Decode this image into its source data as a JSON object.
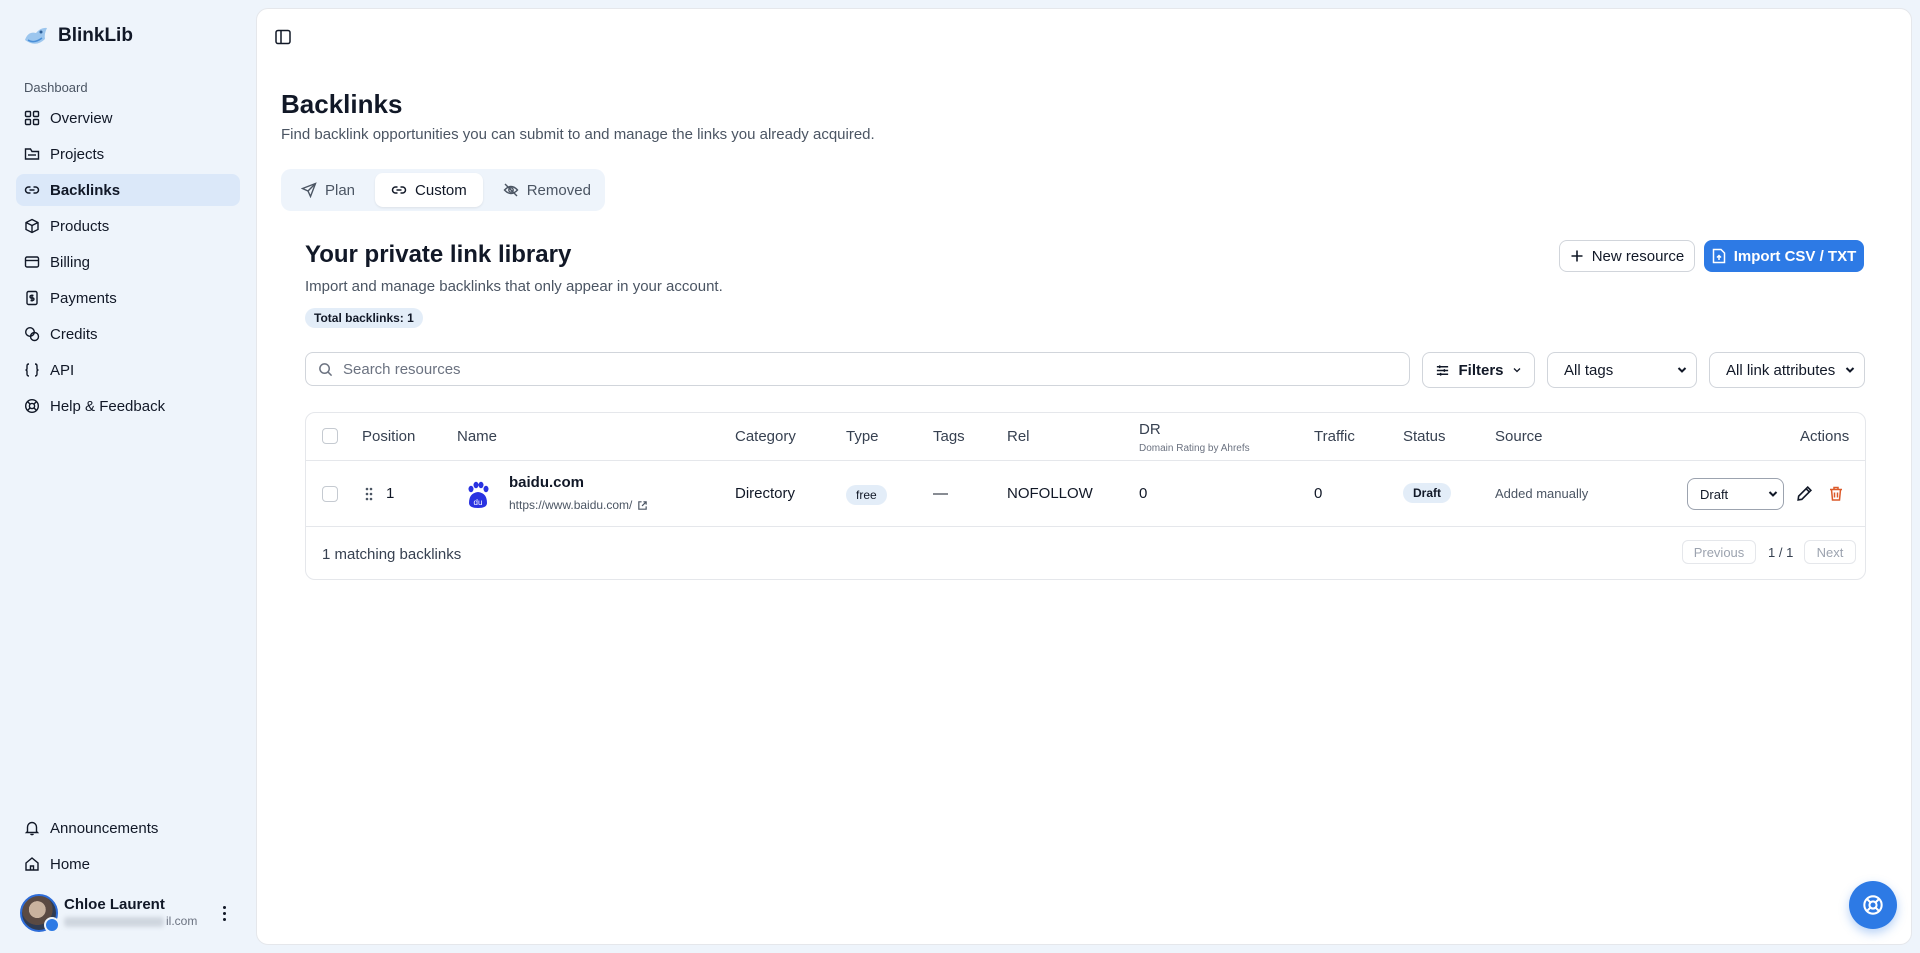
{
  "app": {
    "name": "BlinkLib"
  },
  "sidebar": {
    "section_label": "Dashboard",
    "items": [
      {
        "label": "Overview",
        "icon": "grid-icon"
      },
      {
        "label": "Projects",
        "icon": "folder-icon"
      },
      {
        "label": "Backlinks",
        "icon": "link-icon",
        "active": true
      },
      {
        "label": "Products",
        "icon": "package-icon"
      },
      {
        "label": "Billing",
        "icon": "wallet-icon"
      },
      {
        "label": "Payments",
        "icon": "receipt-icon"
      },
      {
        "label": "Credits",
        "icon": "coins-icon"
      },
      {
        "label": "API",
        "icon": "braces-icon"
      },
      {
        "label": "Help & Feedback",
        "icon": "lifebuoy-icon"
      }
    ],
    "bottom_items": [
      {
        "label": "Announcements",
        "icon": "bell-icon"
      },
      {
        "label": "Home",
        "icon": "home-icon"
      }
    ],
    "user": {
      "name": "Chloe Laurent",
      "email_visible": "il.com"
    }
  },
  "page": {
    "title": "Backlinks",
    "subtitle": "Find backlink opportunities you can submit to and manage the links you already acquired.",
    "tabs": [
      {
        "label": "Plan",
        "icon": "send-icon"
      },
      {
        "label": "Custom",
        "icon": "link-icon",
        "active": true
      },
      {
        "label": "Removed",
        "icon": "eye-off-icon"
      }
    ]
  },
  "library": {
    "title": "Your private link library",
    "subtitle": "Import and manage backlinks that only appear in your account.",
    "total_badge": "Total backlinks: 1",
    "new_resource_label": "New resource",
    "import_label": "Import CSV / TXT",
    "search_placeholder": "Search resources",
    "filters_label": "Filters",
    "tags_select": "All tags",
    "attributes_select": "All link attributes"
  },
  "table": {
    "columns": {
      "position": "Position",
      "name": "Name",
      "category": "Category",
      "type": "Type",
      "tags": "Tags",
      "rel": "Rel",
      "dr": "DR",
      "dr_sub": "Domain Rating by Ahrefs",
      "traffic": "Traffic",
      "status": "Status",
      "source": "Source",
      "actions": "Actions"
    },
    "rows": [
      {
        "position": "1",
        "name": "baidu.com",
        "url": "https://www.baidu.com/",
        "category": "Directory",
        "type": "free",
        "tags": "—",
        "rel": "NOFOLLOW",
        "dr": "0",
        "traffic": "0",
        "status": "Draft",
        "source": "Added manually",
        "status_select": "Draft"
      }
    ],
    "footer": {
      "count": "1 matching backlinks",
      "previous": "Previous",
      "page": "1 / 1",
      "next": "Next"
    }
  },
  "colors": {
    "accent": "#2d7ae5",
    "sidebar_bg": "#eef4fb",
    "active_nav": "#dbe8f9",
    "delete": "#dc5a2a"
  }
}
